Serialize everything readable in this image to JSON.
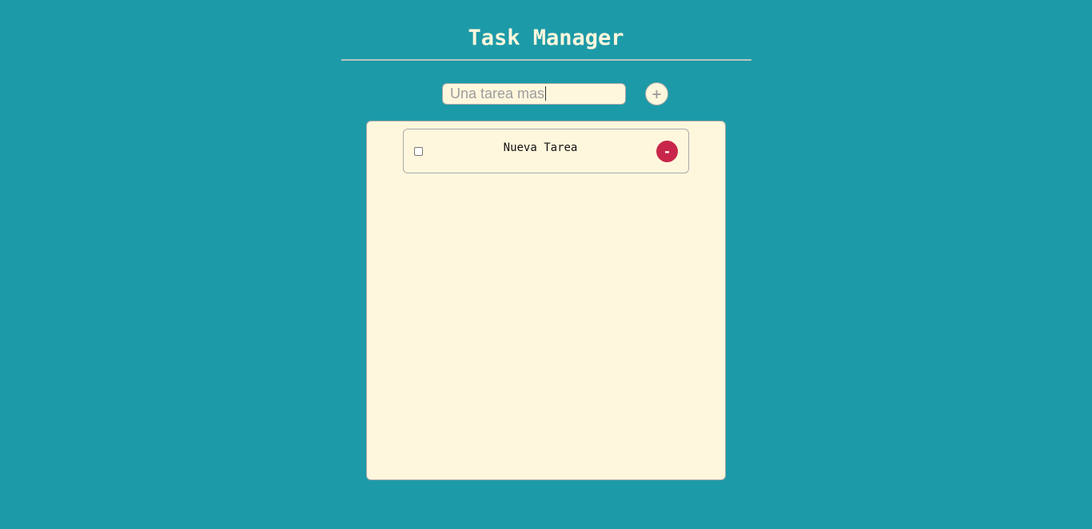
{
  "header": {
    "title": "Task Manager"
  },
  "new_task": {
    "value": "Una tarea mas",
    "add_label": "+"
  },
  "tasks": [
    {
      "label": "Nueva Tarea",
      "checked": false,
      "delete_label": "-"
    }
  ],
  "colors": {
    "background": "#1d9aa8",
    "panel": "#fff7dd",
    "title": "#fff7dd",
    "delete": "#c8264a"
  }
}
